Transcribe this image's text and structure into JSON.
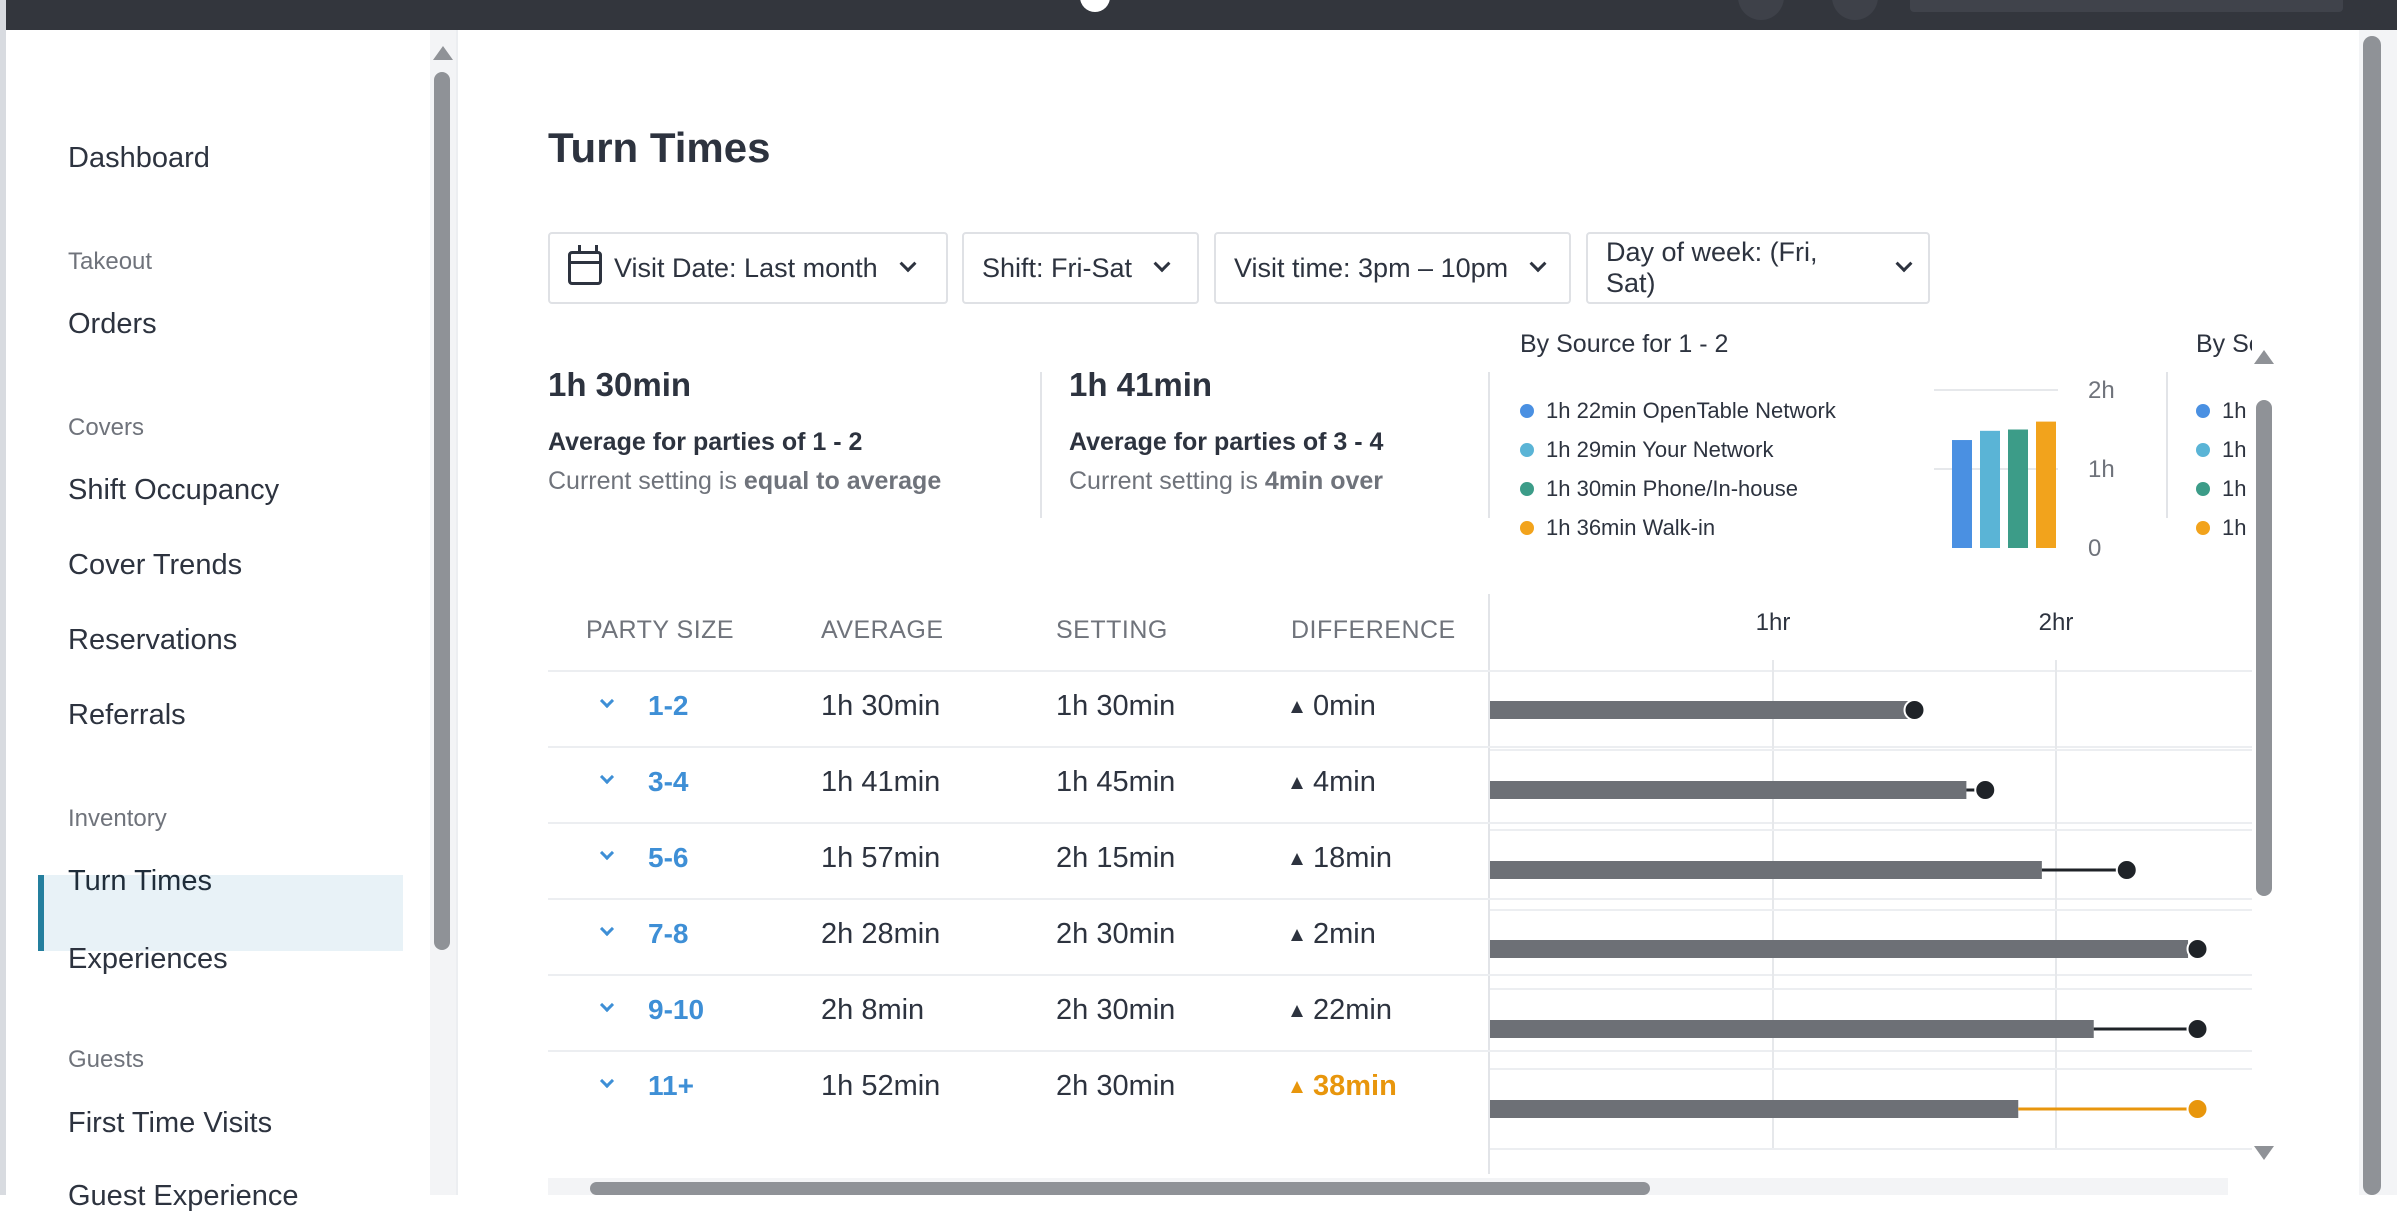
{
  "sidebar": {
    "items": [
      {
        "label": "Dashboard"
      },
      {
        "heading": "Takeout"
      },
      {
        "label": "Orders"
      },
      {
        "heading": "Covers"
      },
      {
        "label": "Shift Occupancy"
      },
      {
        "label": "Cover Trends"
      },
      {
        "label": "Reservations"
      },
      {
        "label": "Referrals"
      },
      {
        "heading": "Inventory"
      },
      {
        "label": "Turn Times",
        "active": true
      },
      {
        "label": "Experiences"
      },
      {
        "heading": "Guests"
      },
      {
        "label": "First Time Visits"
      },
      {
        "label": "Guest Experience"
      }
    ]
  },
  "page": {
    "title": "Turn Times"
  },
  "filters": {
    "visit_date": "Visit Date: Last month",
    "shift": "Shift: Fri-Sat",
    "visit_time": "Visit time: 3pm – 10pm",
    "day_of_week": "Day of week: (Fri, Sat)"
  },
  "summary": [
    {
      "value": "1h 30min",
      "label": "Average for parties of 1 - 2",
      "sub_prefix": "Current setting is",
      "sub_value": "equal to average"
    },
    {
      "value": "1h 41min",
      "label": "Average for parties of 3 - 4",
      "sub_prefix": "Current setting is",
      "sub_value": "4min over"
    }
  ],
  "by_source": {
    "title": "By Source for 1 - 2",
    "title_truncated": "By Sc",
    "legend": [
      {
        "text": "1h 22min OpenTable Network",
        "color": "#4a90e2"
      },
      {
        "text": "1h 29min Your Network",
        "color": "#5ab4d6"
      },
      {
        "text": "1h 30min Phone/In-house",
        "color": "#3c9c88"
      },
      {
        "text": "1h 36min Walk-in",
        "color": "#f2a31c"
      }
    ],
    "truncated_legend": [
      "1h !",
      "1h :",
      "1h !",
      "1h :"
    ],
    "axis_ticks": [
      "2h",
      "1h",
      "0"
    ]
  },
  "table": {
    "headers": [
      "PARTY SIZE",
      "AVERAGE",
      "SETTING",
      "DIFFERENCE"
    ],
    "axis_ticks": [
      "1hr",
      "2hr"
    ],
    "rows": [
      {
        "party": "1-2",
        "average": "1h 30min",
        "setting": "1h 30min",
        "difference": "0min",
        "over": false
      },
      {
        "party": "3-4",
        "average": "1h 41min",
        "setting": "1h 45min",
        "difference": "4min",
        "over": false
      },
      {
        "party": "5-6",
        "average": "1h 57min",
        "setting": "2h 15min",
        "difference": "18min",
        "over": false
      },
      {
        "party": "7-8",
        "average": "2h 28min",
        "setting": "2h 30min",
        "difference": "2min",
        "over": false
      },
      {
        "party": "9-10",
        "average": "2h 8min",
        "setting": "2h 30min",
        "difference": "22min",
        "over": false
      },
      {
        "party": "11+",
        "average": "1h 52min",
        "setting": "2h 30min",
        "difference": "38min",
        "over": true
      }
    ]
  },
  "chart_data": [
    {
      "type": "bar",
      "title": "By Source for 1 - 2",
      "categories": [
        "OpenTable Network",
        "Your Network",
        "Phone/In-house",
        "Walk-in"
      ],
      "values_min": [
        82,
        89,
        90,
        96
      ],
      "ylim_hours": [
        0,
        2
      ]
    },
    {
      "type": "bar",
      "title": "",
      "categories": [
        "1-2",
        "3-4",
        "5-6",
        "7-8",
        "9-10",
        "11+"
      ],
      "series": [
        {
          "name": "AVERAGE",
          "values_min": [
            90,
            101,
            117,
            148,
            128,
            112
          ]
        },
        {
          "name": "SETTING",
          "values_min": [
            90,
            105,
            135,
            150,
            150,
            150
          ]
        }
      ],
      "x_ticks": [
        "1hr",
        "2hr"
      ]
    }
  ],
  "colors": {
    "accent": "#3e8fd6",
    "over": "#e8960c",
    "bar": "#6d7076",
    "active_nav": "#247f9e"
  }
}
